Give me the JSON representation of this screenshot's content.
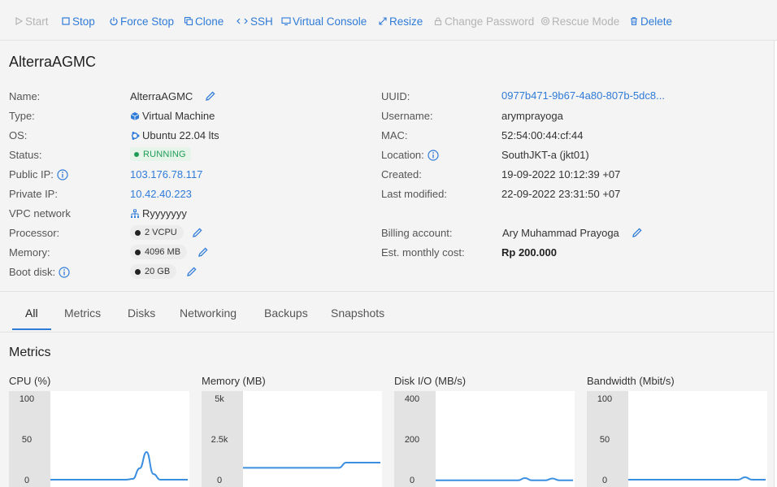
{
  "toolbar": {
    "start": "Start",
    "stop": "Stop",
    "force_stop": "Force Stop",
    "clone": "Clone",
    "ssh": "SSH",
    "virtual_console": "Virtual Console",
    "resize": "Resize",
    "change_password": "Change Password",
    "rescue_mode": "Rescue Mode",
    "delete": "Delete"
  },
  "vm": {
    "title": "AlterraAGMC",
    "left": {
      "name_label": "Name:",
      "name": "AlterraAGMC",
      "type_label": "Type:",
      "type": "Virtual Machine",
      "os_label": "OS:",
      "os": "Ubuntu 22.04 lts",
      "status_label": "Status:",
      "status": "RUNNING",
      "public_ip_label": "Public IP:",
      "public_ip": "103.176.78.117",
      "private_ip_label": "Private IP:",
      "private_ip": "10.42.40.223",
      "vpc_label": "VPC network",
      "vpc": "Ryyyyyyy",
      "processor_label": "Processor:",
      "processor": "2 VCPU",
      "memory_label": "Memory:",
      "memory": "4096 MB",
      "boot_disk_label": "Boot disk:",
      "boot_disk": "20 GB"
    },
    "right": {
      "uuid_label": "UUID:",
      "uuid": "0977b471-9b67-4a80-807b-5dc8...",
      "username_label": "Username:",
      "username": "arymprayoga",
      "mac_label": "MAC:",
      "mac": "52:54:00:44:cf:44",
      "location_label": "Location:",
      "location": "SouthJKT-a (jkt01)",
      "created_label": "Created:",
      "created": "19-09-2022 10:12:39 +07",
      "modified_label": "Last modified:",
      "modified": "22-09-2022 23:31:50 +07",
      "billing_label": "Billing account:",
      "billing": "Ary Muhammad Prayoga",
      "cost_label": "Est. monthly cost:",
      "cost": "Rp 200.000"
    }
  },
  "tabs": [
    "All",
    "Metrics",
    "Disks",
    "Networking",
    "Backups",
    "Snapshots"
  ],
  "metrics": {
    "title": "Metrics"
  },
  "colors": {
    "accent": "#2f7bd8",
    "status_running": "#1f9d55",
    "line": "#3b8fe0"
  },
  "chart_data": [
    {
      "type": "line",
      "title": "CPU (%)",
      "yticks": [
        "100",
        "50",
        "0"
      ],
      "ylim": [
        0,
        100
      ],
      "x": [
        0,
        5,
        10,
        15,
        20,
        25,
        30,
        35,
        40,
        45,
        50,
        55,
        60,
        65,
        70,
        75,
        80,
        85,
        90,
        95,
        100
      ],
      "series": [
        {
          "values": [
            1,
            1,
            1,
            1,
            1,
            1,
            1,
            1,
            1,
            1,
            1,
            1,
            2,
            15,
            35,
            8,
            1,
            1,
            1,
            1,
            1
          ]
        }
      ]
    },
    {
      "type": "line",
      "title": "Memory (MB)",
      "yticks": [
        "5k",
        "2.5k",
        "0"
      ],
      "ylim": [
        0,
        5000
      ],
      "x": [
        0,
        5,
        10,
        15,
        20,
        25,
        30,
        35,
        40,
        45,
        50,
        55,
        60,
        65,
        70,
        75,
        80,
        85,
        90,
        95,
        100
      ],
      "series": [
        {
          "values": [
            780,
            780,
            780,
            780,
            780,
            780,
            780,
            780,
            780,
            780,
            780,
            780,
            780,
            780,
            780,
            1100,
            1100,
            1100,
            1100,
            1100,
            1100
          ]
        }
      ]
    },
    {
      "type": "line",
      "title": "Disk I/O (MB/s)",
      "yticks": [
        "400",
        "200",
        "0"
      ],
      "ylim": [
        0,
        400
      ],
      "x": [
        0,
        5,
        10,
        15,
        20,
        25,
        30,
        35,
        40,
        45,
        50,
        55,
        60,
        65,
        70,
        75,
        80,
        85,
        90,
        95,
        100
      ],
      "series": [
        {
          "values": [
            1,
            1,
            1,
            1,
            1,
            1,
            1,
            1,
            1,
            1,
            1,
            1,
            1,
            12,
            1,
            1,
            1,
            10,
            1,
            1,
            1
          ]
        }
      ]
    },
    {
      "type": "line",
      "title": "Bandwidth (Mbit/s)",
      "yticks": [
        "100",
        "50",
        "0"
      ],
      "ylim": [
        0,
        100
      ],
      "x": [
        0,
        5,
        10,
        15,
        20,
        25,
        30,
        35,
        40,
        45,
        50,
        55,
        60,
        65,
        70,
        75,
        80,
        85,
        90,
        95,
        100
      ],
      "series": [
        {
          "values": [
            1,
            1,
            1,
            1,
            1,
            1,
            1,
            1,
            1,
            1,
            1,
            1,
            1,
            1,
            1,
            1,
            1,
            4,
            1,
            1,
            1
          ]
        }
      ]
    }
  ]
}
